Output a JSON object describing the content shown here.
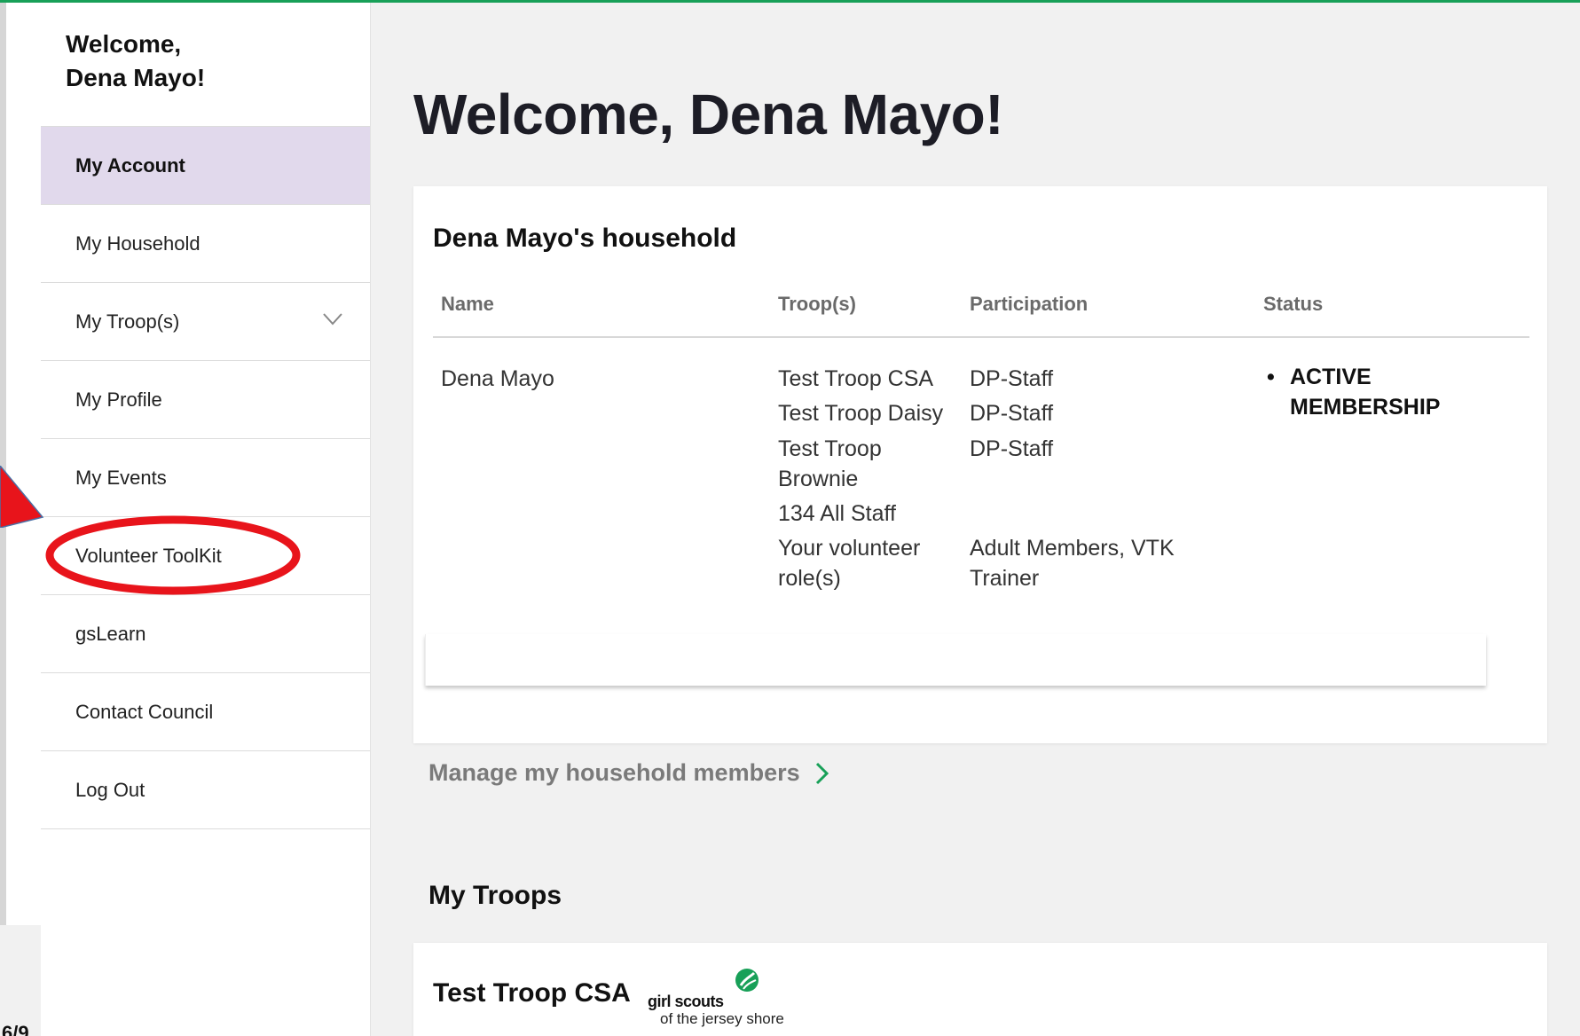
{
  "sidebar": {
    "welcome_line1": "Welcome,",
    "welcome_line2": "Dena Mayo!",
    "items": [
      {
        "label": "My Account",
        "active": true
      },
      {
        "label": "My Household"
      },
      {
        "label": "My Troop(s)",
        "icon": "chevron-down-icon"
      },
      {
        "label": "My Profile"
      },
      {
        "label": "My Events"
      },
      {
        "label": "Volunteer ToolKit"
      },
      {
        "label": "gsLearn"
      },
      {
        "label": "Contact Council"
      },
      {
        "label": "Log Out"
      }
    ]
  },
  "main": {
    "title": "Welcome, Dena Mayo!",
    "household": {
      "title": "Dena Mayo's household",
      "columns": [
        "Name",
        "Troop(s)",
        "Participation",
        "Status"
      ],
      "member_name": "Dena Mayo",
      "troops": [
        {
          "troop": "Test Troop CSA",
          "participation": "DP-Staff"
        },
        {
          "troop": "Test Troop Daisy",
          "participation": "DP-Staff"
        },
        {
          "troop_line1": "Test Troop",
          "troop_line2": "Brownie",
          "participation": "DP-Staff"
        },
        {
          "troop": "134 All Staff",
          "participation": ""
        },
        {
          "troop_line1": "Your volunteer",
          "troop_line2": "role(s)",
          "participation_line1": "Adult Members, VTK",
          "participation_line2": "Trainer"
        }
      ],
      "status_bullet": "•",
      "status_line1": "ACTIVE",
      "status_line2": "MEMBERSHIP"
    },
    "manage_link": "Manage my household members",
    "my_troops_title": "My Troops",
    "troop_card": {
      "name": "Test Troop CSA",
      "logo_line1": "girl scouts",
      "logo_line2": "of the jersey shore"
    }
  },
  "colors": {
    "accent_green": "#18a058",
    "active_nav_bg": "#e1d9ec",
    "annotation_red": "#e8141b"
  },
  "corner_text": "6/9"
}
